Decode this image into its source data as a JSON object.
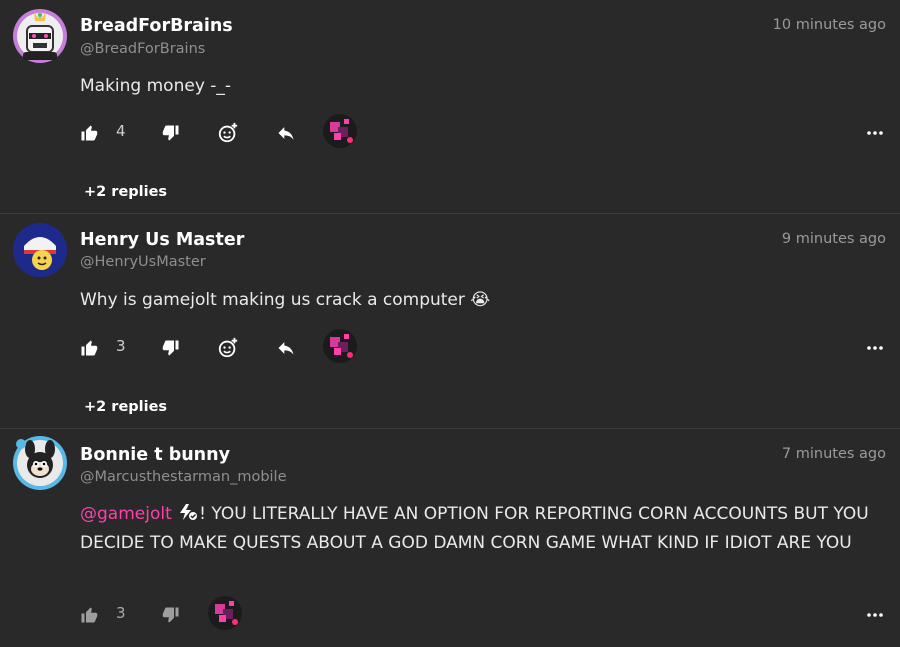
{
  "comments": [
    {
      "name": "BreadForBrains",
      "handle": "@BreadForBrains",
      "time": "10 minutes ago",
      "body": "Making money -_-",
      "likes": "4",
      "replies": "+2 replies"
    },
    {
      "name": "Henry Us Master",
      "handle": "@HenryUsMaster",
      "time": "9 minutes ago",
      "body": "Why is gamejolt making us crack a computer 😭",
      "likes": "3",
      "replies": "+2 replies"
    },
    {
      "name": "Bonnie t bunny",
      "handle": "@Marcusthestarman_mobile",
      "time": "7 minutes ago",
      "mention": "@gamejolt",
      "body": "! YOU LITERALLY HAVE AN OPTION FOR REPORTING CORN ACCOUNTS BUT YOU DECIDE TO MAKE QUESTS ABOUT A GOD DAMN CORN GAME WHAT KIND IF IDIOT ARE YOU",
      "likes": "3"
    }
  ],
  "colors": {
    "background": "#292929",
    "mention": "#ff3fac",
    "muted": "#8f8f8f"
  },
  "icons": {
    "like": "thumbs-up-icon",
    "dislike": "thumbs-down-icon",
    "react": "add-reaction-icon",
    "reply": "reply-icon",
    "more": "more-options-icon"
  }
}
